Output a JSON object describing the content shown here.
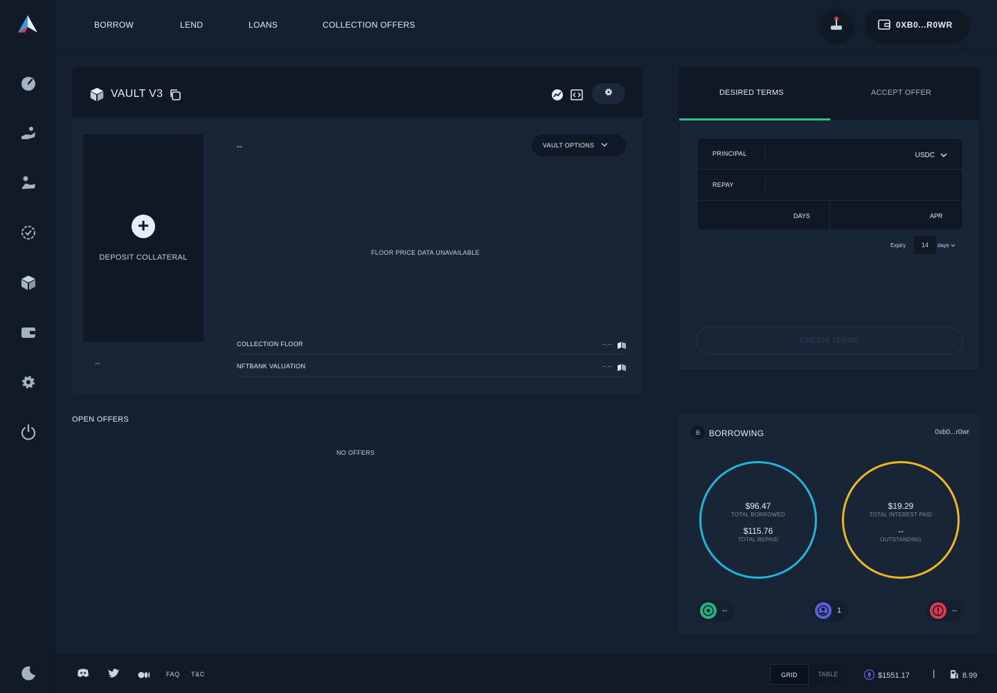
{
  "nav": {
    "items": [
      "BORROW",
      "LEND",
      "LOANS",
      "COLLECTION OFFERS"
    ],
    "wallet_label": "0XB0...R0WR"
  },
  "sidebar": {
    "icons": [
      "dashboard-icon",
      "borrow-hand-icon",
      "lend-hand-icon",
      "loans-check-icon",
      "vault-box-icon",
      "wallet-icon",
      "settings-icon",
      "power-icon",
      "moon-icon"
    ]
  },
  "vault": {
    "title": "VAULT V3",
    "deposit_label": "DEPOSIT COLLATERAL",
    "vault_value": "--",
    "floor_header": "--",
    "options_label": "VAULT OPTIONS",
    "floor_unavailable": "FLOOR PRICE DATA UNAVAILABLE",
    "stats": [
      {
        "label": "COLLECTION FLOOR",
        "value": "--.--"
      },
      {
        "label": "NFTBANK VALUATION",
        "value": "--.--"
      }
    ]
  },
  "offers": {
    "title": "OPEN OFFERS",
    "empty": "NO OFFERS"
  },
  "terms": {
    "tabs": [
      "DESIRED TERMS",
      "ACCEPT OFFER"
    ],
    "principal_label": "PRINCIPAL",
    "currency": "USDC",
    "repay_label": "REPAY",
    "days_label": "DAYS",
    "apr_label": "APR",
    "expiry_label": "Expiry",
    "expiry_value": "14",
    "expiry_unit": "days",
    "create_button": "CREATE TERMS"
  },
  "borrowing": {
    "badge": "B",
    "title": "BORROWING",
    "address": "0xb0...r0wr",
    "ring1": {
      "total_borrowed": "$96.47",
      "total_borrowed_label": "TOTAL BORROWED",
      "total_repaid": "$115.76",
      "total_repaid_label": "TOTAL REPAID",
      "color": "#1fb6d9"
    },
    "ring2": {
      "total_interest": "$19.29",
      "total_interest_label": "TOTAL INTEREST PAID",
      "outstanding": "--",
      "outstanding_label": "OUTSTANDING",
      "color": "#f1b81b"
    },
    "pills": [
      {
        "value": "--",
        "color": "#23b47e"
      },
      {
        "value": "1",
        "color": "#5a5fe0"
      },
      {
        "value": "--",
        "color": "#e0394f"
      }
    ]
  },
  "footer": {
    "faq": "FAQ",
    "tc": "T&C",
    "view_grid": "GRID",
    "view_table": "TABLE",
    "eth_price": "$1551.17",
    "divider": "|",
    "gas": "8.99"
  }
}
